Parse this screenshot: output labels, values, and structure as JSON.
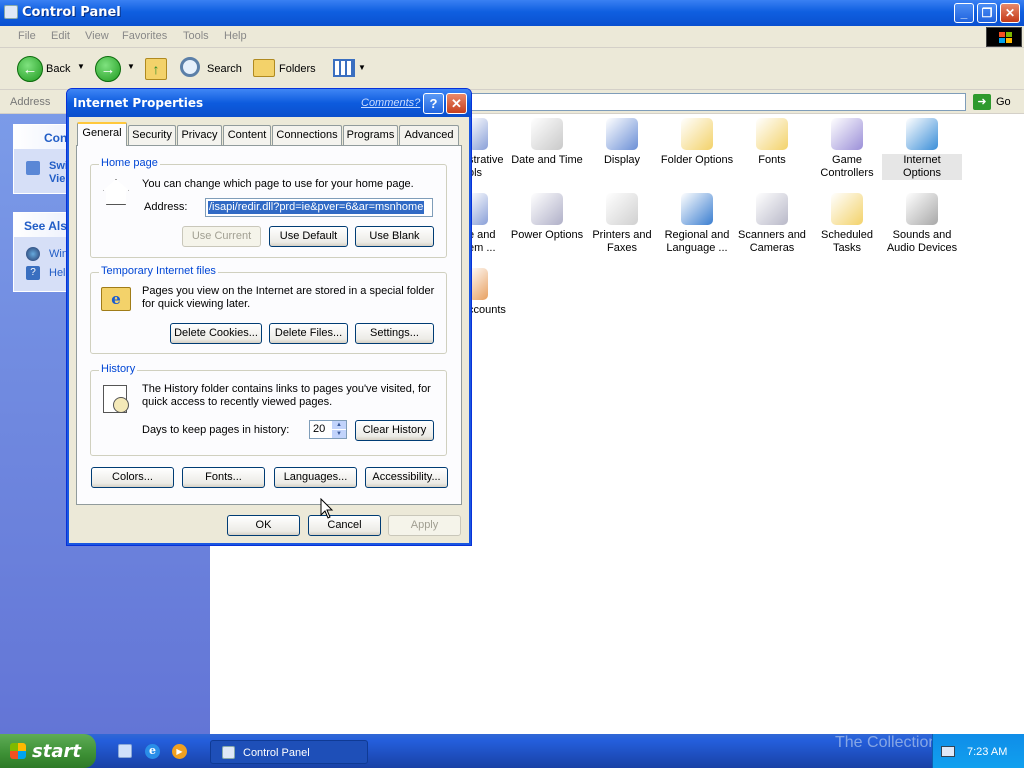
{
  "window": {
    "title": "Control Panel",
    "menu": [
      "File",
      "Edit",
      "View",
      "Favorites",
      "Tools",
      "Help"
    ],
    "toolbar": {
      "back": "Back",
      "search": "Search",
      "folders": "Folders"
    },
    "address_label": "Address",
    "go_label": "Go"
  },
  "left_panel": {
    "box1_heading": "Con",
    "box1_items": [
      "Swi",
      "Vie"
    ],
    "box2_heading": "See Als",
    "box2_items": [
      "Win",
      "Help"
    ]
  },
  "icons": [
    {
      "label": "strative\nols",
      "color": "#8aa0d8"
    },
    {
      "label": "Date and Time",
      "color": "#c9c9c9"
    },
    {
      "label": "Display",
      "color": "#6b8fd6"
    },
    {
      "label": "Folder Options",
      "color": "#f3d26a"
    },
    {
      "label": "Fonts",
      "color": "#f3d26a"
    },
    {
      "label": "Game\nControllers",
      "color": "#9b8fd8"
    },
    {
      "label": "Internet\nOptions",
      "color": "#3a8ed8"
    },
    {
      "label": "e and\nem ...",
      "color": "#8aa0d8"
    },
    {
      "label": "Power Options",
      "color": "#b0b0c8"
    },
    {
      "label": "Printers and\nFaxes",
      "color": "#d0d0d0"
    },
    {
      "label": "Regional and\nLanguage ...",
      "color": "#3a7ed0"
    },
    {
      "label": "Scanners and\nCameras",
      "color": "#b8b8c8"
    },
    {
      "label": "Scheduled\nTasks",
      "color": "#f3d26a"
    },
    {
      "label": "Sounds and\nAudio Devices",
      "color": "#a8a8a8"
    },
    {
      "label": "ccounts",
      "color": "#e8a060"
    }
  ],
  "dialog": {
    "title": "Internet Properties",
    "comments": "Comments?",
    "tabs": [
      "General",
      "Security",
      "Privacy",
      "Content",
      "Connections",
      "Programs",
      "Advanced"
    ],
    "home": {
      "legend": "Home page",
      "desc": "You can change which page to use for your home page.",
      "address_label": "Address:",
      "address_value": "/isapi/redir.dll?prd=ie&pver=6&ar=msnhome",
      "use_current": "Use Current",
      "use_default": "Use Default",
      "use_blank": "Use Blank"
    },
    "temp": {
      "legend": "Temporary Internet files",
      "desc1": "Pages you view on the Internet are stored in a special folder",
      "desc2": "for quick viewing later.",
      "delete_cookies": "Delete Cookies...",
      "delete_files": "Delete Files...",
      "settings": "Settings..."
    },
    "history": {
      "legend": "History",
      "desc1": "The History folder contains links to pages you've visited, for",
      "desc2": "quick access to recently viewed pages.",
      "days_label": "Days to keep pages in history:",
      "days_value": "20",
      "clear": "Clear History"
    },
    "bottom": {
      "colors": "Colors...",
      "fonts": "Fonts...",
      "languages": "Languages...",
      "accessibility": "Accessibility..."
    },
    "ok": "OK",
    "cancel": "Cancel",
    "apply": "Apply"
  },
  "taskbar": {
    "start": "start",
    "task": "Control Panel",
    "clock": "7:23 AM",
    "watermark": "The Collection Book"
  }
}
